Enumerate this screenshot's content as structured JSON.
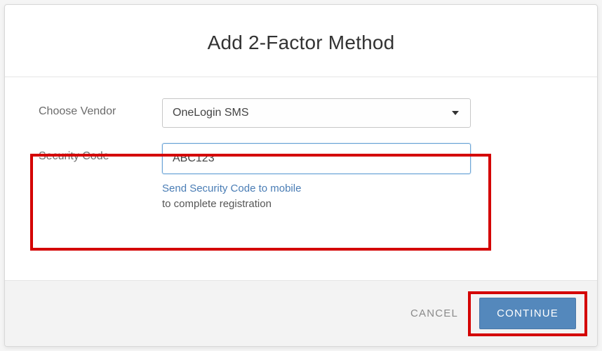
{
  "modal": {
    "title": "Add 2-Factor Method"
  },
  "form": {
    "vendor_label": "Choose Vendor",
    "vendor_value": "OneLogin SMS",
    "security_code_label": "Security Code",
    "security_code_value": "ABC123",
    "help_link": "Send Security Code to mobile",
    "help_text": "to complete registration"
  },
  "footer": {
    "cancel_label": "CANCEL",
    "continue_label": "CONTINUE"
  }
}
